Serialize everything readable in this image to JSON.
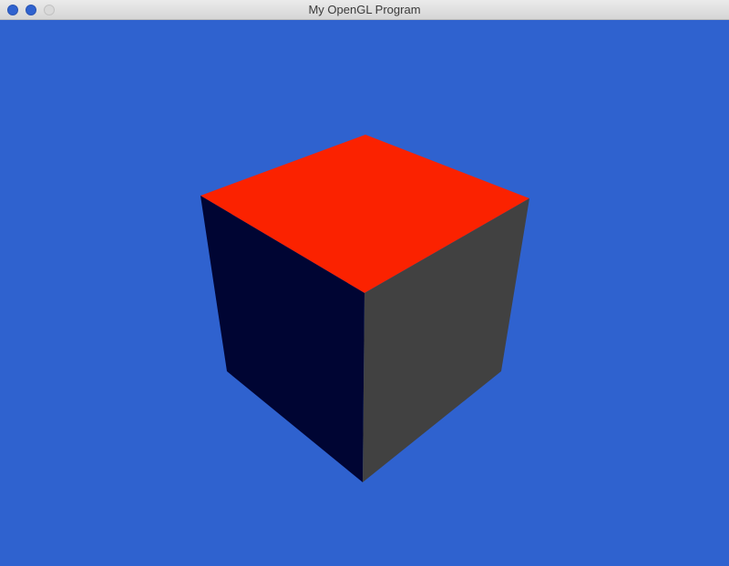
{
  "window": {
    "title": "My OpenGL Program",
    "controls": [
      "close",
      "minimize",
      "zoom"
    ]
  },
  "scene": {
    "background_color": "#2f62cf",
    "object": "cube",
    "faces": {
      "top": "#fb2200",
      "left": "#000533",
      "right": "#414141"
    }
  }
}
